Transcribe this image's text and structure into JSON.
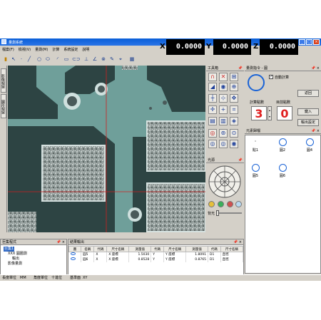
{
  "window": {
    "title": "量測系統"
  },
  "coords": [
    {
      "axis": "X",
      "value": "0.0000"
    },
    {
      "axis": "Y",
      "value": "0.0000"
    },
    {
      "axis": "Z",
      "value": "0.0000"
    }
  ],
  "menu": [
    "檔案(F)",
    "檢視(V)",
    "量測(M)",
    "計算",
    "系統設定",
    "說明"
  ],
  "left_tabs": [
    "影像視窗",
    "圖形視窗"
  ],
  "tool_panel": {
    "title": "工具箱"
  },
  "light_panel": {
    "title": "光源",
    "label": "背光"
  },
  "measure_panel": {
    "title": "量測指令 - 圓",
    "auto_calc_label": "自動計算",
    "auto_calc_checked": true,
    "calc_points_label": "計算點數",
    "calc_points_value": "3",
    "acquired_points_label": "目前點數",
    "acquired_points_value": "0",
    "back_button": "返回",
    "enter_button": "鍵入",
    "output_settings_button": "輸出設定"
  },
  "element_panel": {
    "title": "元素歸檔",
    "items": [
      {
        "label": "點1",
        "icon": "point-icon"
      },
      {
        "label": "圓2",
        "icon": "circle-icon"
      },
      {
        "label": "圓4",
        "icon": "circle-icon"
      },
      {
        "label": "圓5",
        "icon": "circle-icon"
      },
      {
        "label": "圓6",
        "icon": "circle-icon"
      }
    ]
  },
  "program_panel": {
    "title": "巨集程式",
    "tree": [
      "巨集1",
      "XXX 圓圈測",
      "輸出",
      "影像量測"
    ]
  },
  "result_panel": {
    "title": "結果輸出",
    "columns": [
      "圖",
      "名稱",
      "代碼",
      "尺寸名稱",
      "測量值",
      "代碼",
      "尺寸名稱",
      "測量值",
      "代碼",
      "尺寸名稱"
    ],
    "rows": [
      [
        "",
        "圓5",
        "X",
        "X 座標",
        "1.5030",
        "Y",
        "Y 座標",
        "1.8091",
        "D1",
        "直徑"
      ],
      [
        "",
        "圓6",
        "X",
        "X 座標",
        "0.8528",
        "Y",
        "Y 座標",
        "0.8765",
        "D1",
        "直徑"
      ]
    ]
  },
  "status": {
    "length_unit_label": "長度單位",
    "length_unit": "MM",
    "angle_unit_label": "角度單位",
    "angle_unit": "十進位",
    "plane_label": "基準面",
    "plane": "XY"
  },
  "colors": {
    "titlebar": "#0a5fd8",
    "coord_bg": "#000000",
    "accent": "#1a63d6",
    "crosshair": "#d02020"
  }
}
